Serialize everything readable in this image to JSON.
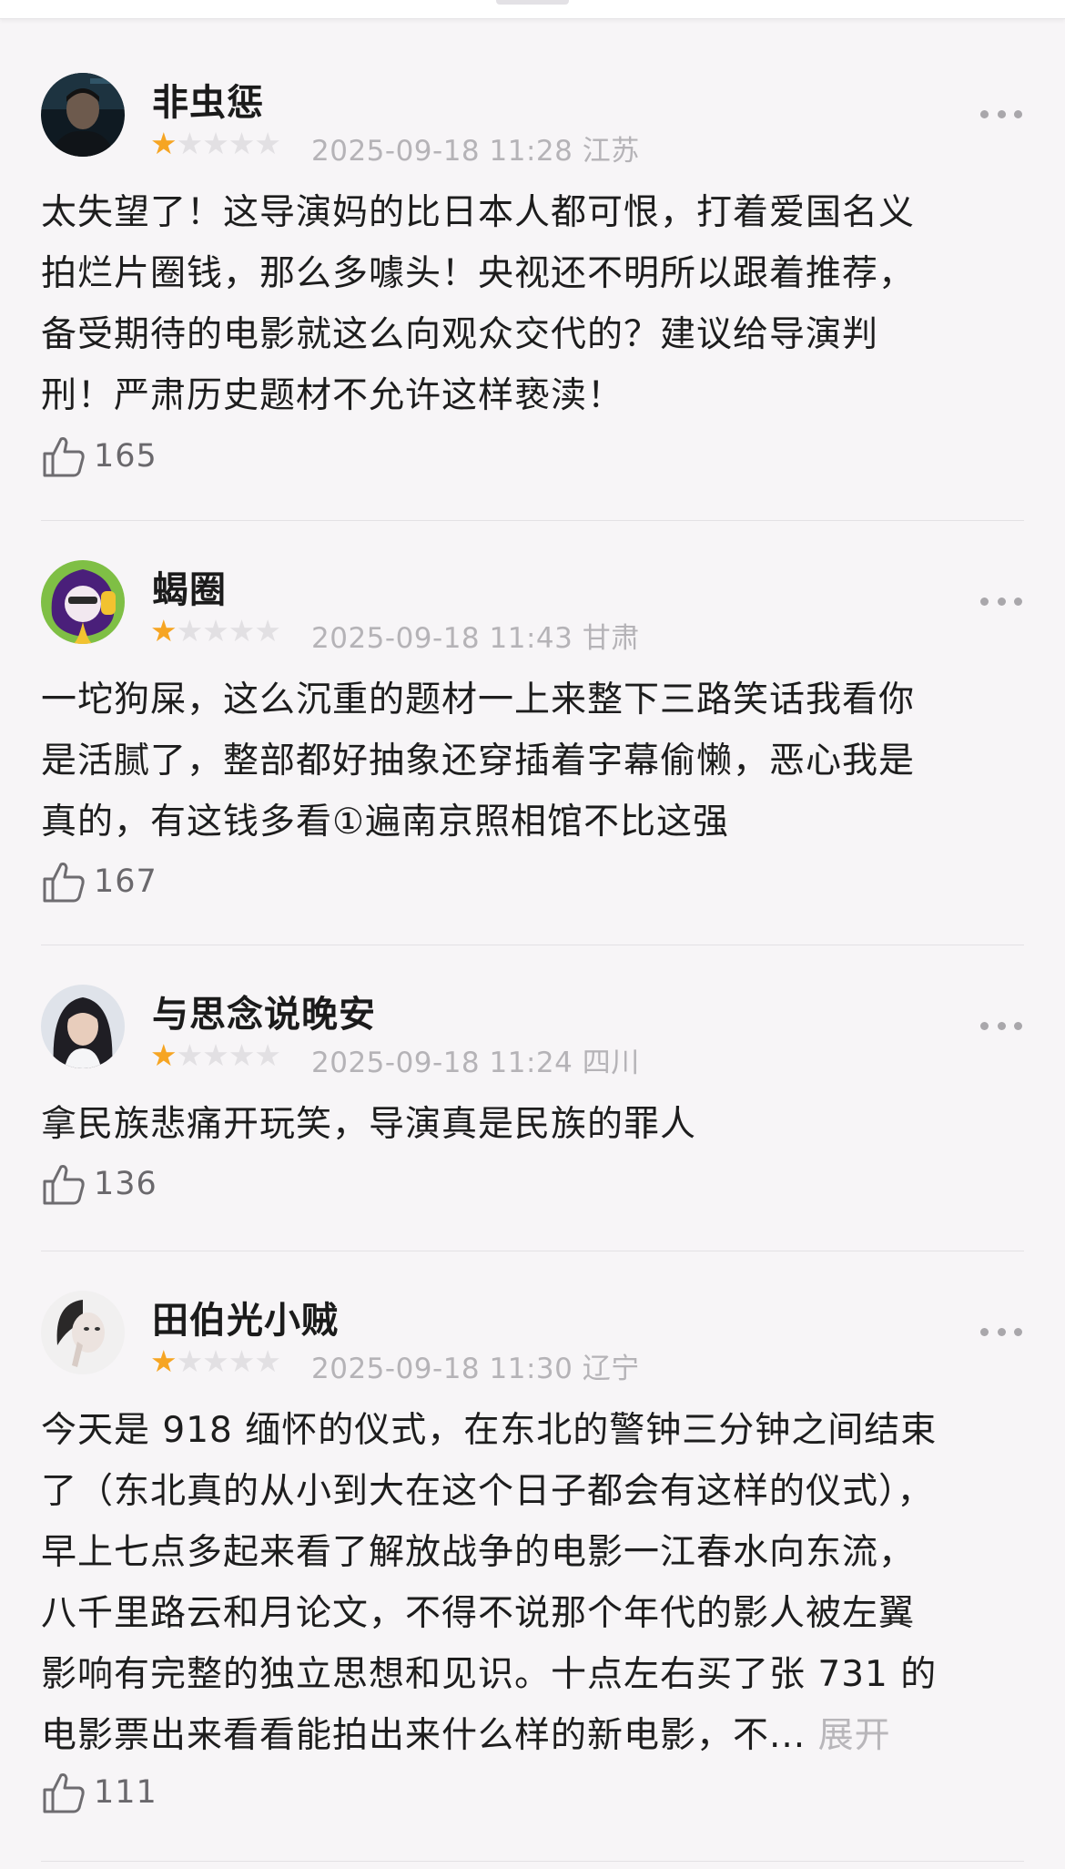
{
  "reviews": [
    {
      "username": "非虫惩",
      "rating": 1,
      "max_rating": 5,
      "date": "2025-09-18 11:28",
      "region": "江苏",
      "content": "太失望了！这导演妈的比日本人都可恨，打着爱国名义\n拍烂片圈钱，那么多噱头！央视还不明所以跟着推荐，\n备受期待的电影就这么向观众交代的？建议给导演判\n刑！严肃历史题材不允许这样亵渎！",
      "likes": "165"
    },
    {
      "username": "蝎圈",
      "rating": 1,
      "max_rating": 5,
      "date": "2025-09-18 11:43",
      "region": "甘肃",
      "content": "一坨狗屎，这么沉重的题材一上来整下三路笑话我看你\n是活腻了，整部都好抽象还穿插着字幕偷懒，恶心我是\n真的，有这钱多看①遍南京照相馆不比这强",
      "likes": "167"
    },
    {
      "username": "与思念说晚安",
      "rating": 1,
      "max_rating": 5,
      "date": "2025-09-18 11:24",
      "region": "四川",
      "content": "拿民族悲痛开玩笑，导演真是民族的罪人",
      "likes": "136"
    },
    {
      "username": "田伯光小贼",
      "rating": 1,
      "max_rating": 5,
      "date": "2025-09-18 11:30",
      "region": "辽宁",
      "content": "今天是 918 缅怀的仪式，在东北的警钟三分钟之间结束\n了（东北真的从小到大在这个日子都会有这样的仪式），\n早上七点多起来看了解放战争的电影一江春水向东流，\n八千里路云和月论文，不得不说那个年代的影人被左翼\n影响有完整的独立思想和见识。十点左右买了张 731 的\n电影票出来看看能拍出来什么样的新电影，不...",
      "expand_label": "展开",
      "likes": "111"
    }
  ],
  "colors": {
    "star_on": "#f6a523",
    "star_off": "#e2e0e3",
    "meta_text": "#b5b3b7",
    "background": "#f7f5f7"
  },
  "icons": {
    "like": "thumbs-up-icon",
    "more": "more-dots-icon",
    "star": "star-icon"
  }
}
